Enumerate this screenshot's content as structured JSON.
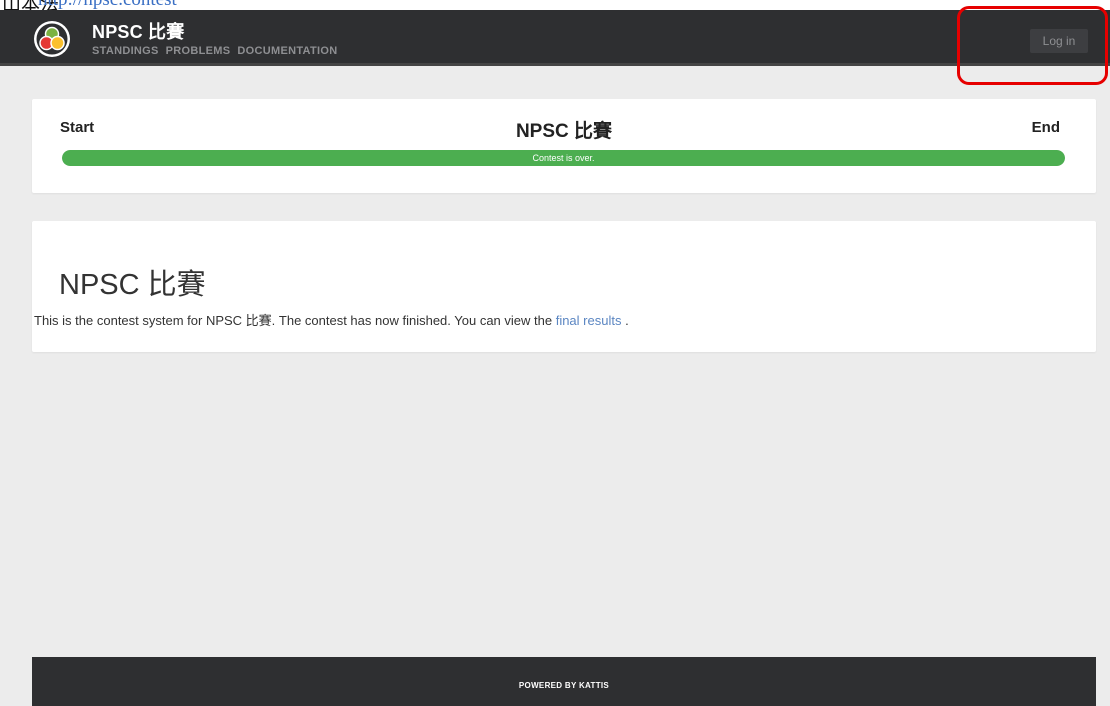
{
  "doc": {
    "leading_text": "山本法",
    "link_text": "http://npsc.contest"
  },
  "navbar": {
    "brand_title": "NPSC 比賽",
    "links": [
      "STANDINGS",
      "PROBLEMS",
      "DOCUMENTATION"
    ],
    "login_label": "Log in"
  },
  "status_card": {
    "start_label": "Start",
    "end_label": "End",
    "contest_title": "NPSC 比賽",
    "progress_text": "Contest is over.",
    "progress_fraction": 1.0,
    "progress_color": "#4cae50"
  },
  "info_card": {
    "heading": "NPSC 比賽",
    "body_prefix": "This is the contest system for NPSC 比賽. The contest has now finished. You can view the ",
    "link_label": "final results",
    "body_suffix": " ."
  },
  "footer": {
    "text": "POWERED BY KATTIS"
  },
  "colors": {
    "navbar_bg": "#2e2f31",
    "page_bg": "#ececec",
    "highlight": "#e60000",
    "link": "#5b86c2"
  }
}
